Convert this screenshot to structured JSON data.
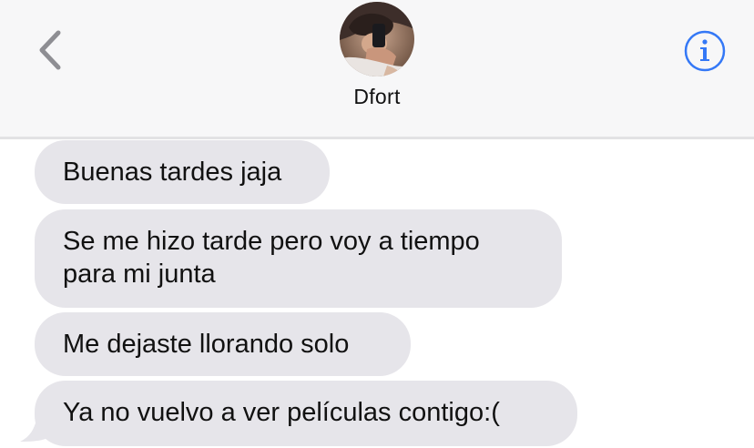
{
  "header": {
    "contact_name": "Dfort",
    "back_icon": "chevron-left-icon",
    "info_icon": "info-circle-icon",
    "accent_color": "#3478f6"
  },
  "messages": [
    {
      "sender": "contact",
      "text": "Buenas tardes jaja"
    },
    {
      "sender": "contact",
      "text": "Se me hizo tarde pero voy a tiempo para mi junta"
    },
    {
      "sender": "contact",
      "text": "Me dejaste llorando solo"
    },
    {
      "sender": "contact",
      "text": "Ya no vuelvo a ver películas contigo:("
    }
  ],
  "bubble_color": "#e6e5ea"
}
